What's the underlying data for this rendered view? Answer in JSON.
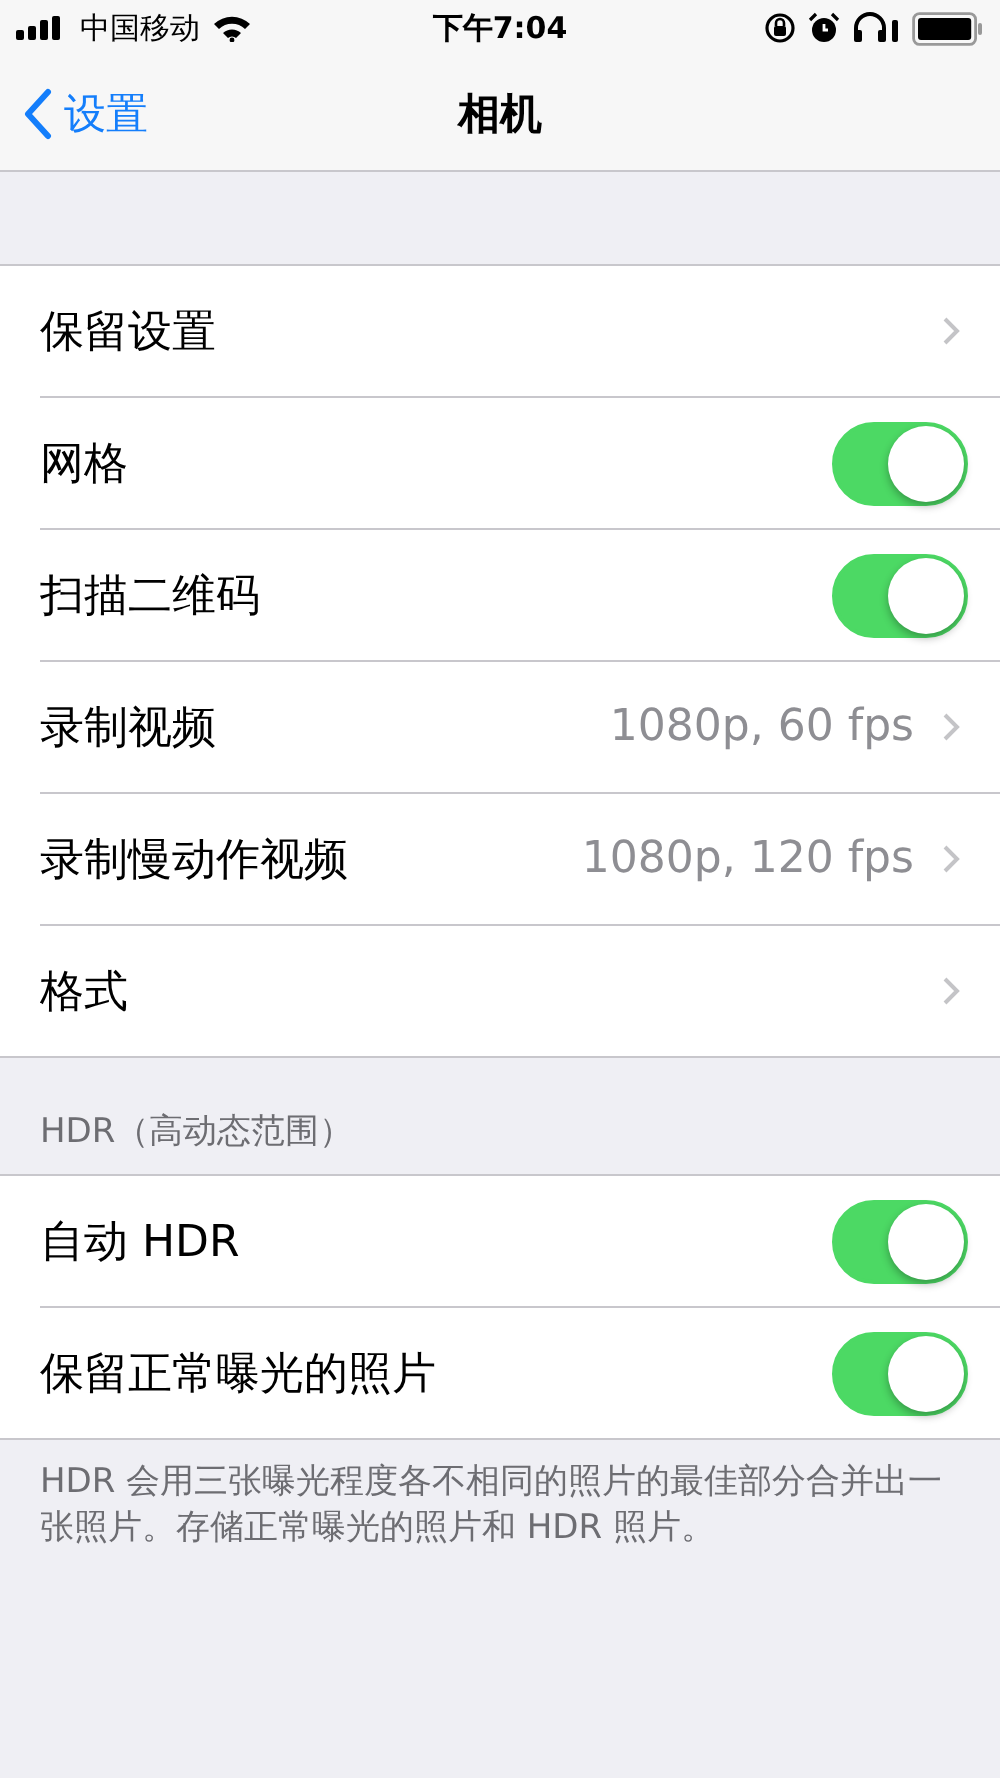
{
  "status_bar": {
    "carrier": "中国移动",
    "time": "下午7:04"
  },
  "nav": {
    "back": "设置",
    "title": "相机"
  },
  "groups": [
    {
      "rows": [
        {
          "kind": "link",
          "label": "保留设置"
        },
        {
          "kind": "toggle",
          "label": "网格",
          "on": true
        },
        {
          "kind": "toggle",
          "label": "扫描二维码",
          "on": true
        },
        {
          "kind": "link",
          "label": "录制视频",
          "value": "1080p, 60 fps"
        },
        {
          "kind": "link",
          "label": "录制慢动作视频",
          "value": "1080p, 120 fps"
        },
        {
          "kind": "link",
          "label": "格式"
        }
      ]
    },
    {
      "header": "HDR（高动态范围）",
      "rows": [
        {
          "kind": "toggle",
          "label": "自动 HDR",
          "on": true
        },
        {
          "kind": "toggle",
          "label": "保留正常曝光的照片",
          "on": true
        }
      ],
      "footer": "HDR 会用三张曝光程度各不相同的照片的最佳部分合并出一张照片。存储正常曝光的照片和 HDR 照片。"
    }
  ]
}
